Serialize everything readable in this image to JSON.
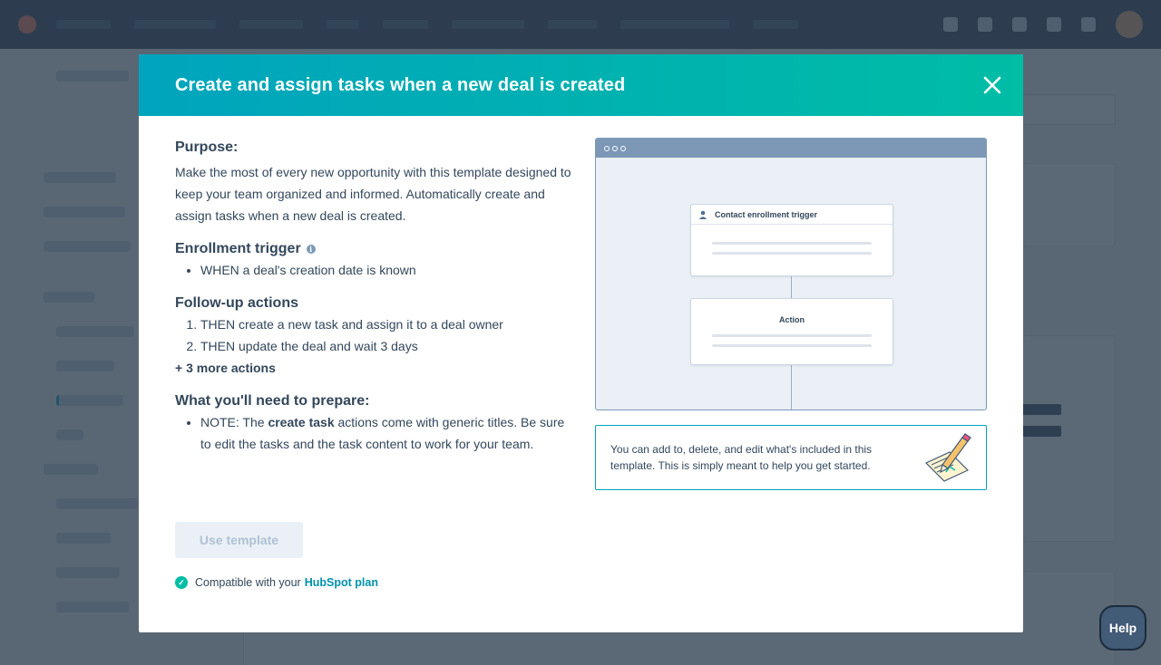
{
  "modal": {
    "title": "Create and assign tasks when a new deal is created",
    "purpose": {
      "heading": "Purpose:",
      "text": "Make the most of every new opportunity with this template designed to keep your team organized and informed. Automatically create and assign tasks when a new deal is created."
    },
    "enrollment": {
      "heading": "Enrollment trigger",
      "items": [
        "WHEN a deal's creation date is known"
      ]
    },
    "followup": {
      "heading": "Follow-up actions",
      "items": [
        "THEN create a new task and assign it to a deal owner",
        "THEN update the deal and wait 3 days"
      ],
      "more": "+ 3 more actions"
    },
    "prepare": {
      "heading": "What you'll need to prepare:",
      "note_prefix": "NOTE: The",
      "note_strong": "create task",
      "note_suffix": "actions come with generic titles. Be sure to edit the tasks and the task content to work for your team."
    },
    "use_template_label": "Use template",
    "compat_text": "Compatible with your",
    "compat_link": "HubSpot plan",
    "preview": {
      "trigger_label": "Contact enrollment trigger",
      "action_label": "Action"
    },
    "note_text": "You can add to, delete, and edit what's included in this template. This is simply meant to help you get started."
  },
  "help_label": "Help",
  "colors": {
    "header_start": "#00a4bd",
    "header_end": "#00bda5",
    "text": "#33475b",
    "link": "#0091ae",
    "success": "#00bda5",
    "disabled_text": "#b0c1d4",
    "overlay": "#2d3e50"
  }
}
